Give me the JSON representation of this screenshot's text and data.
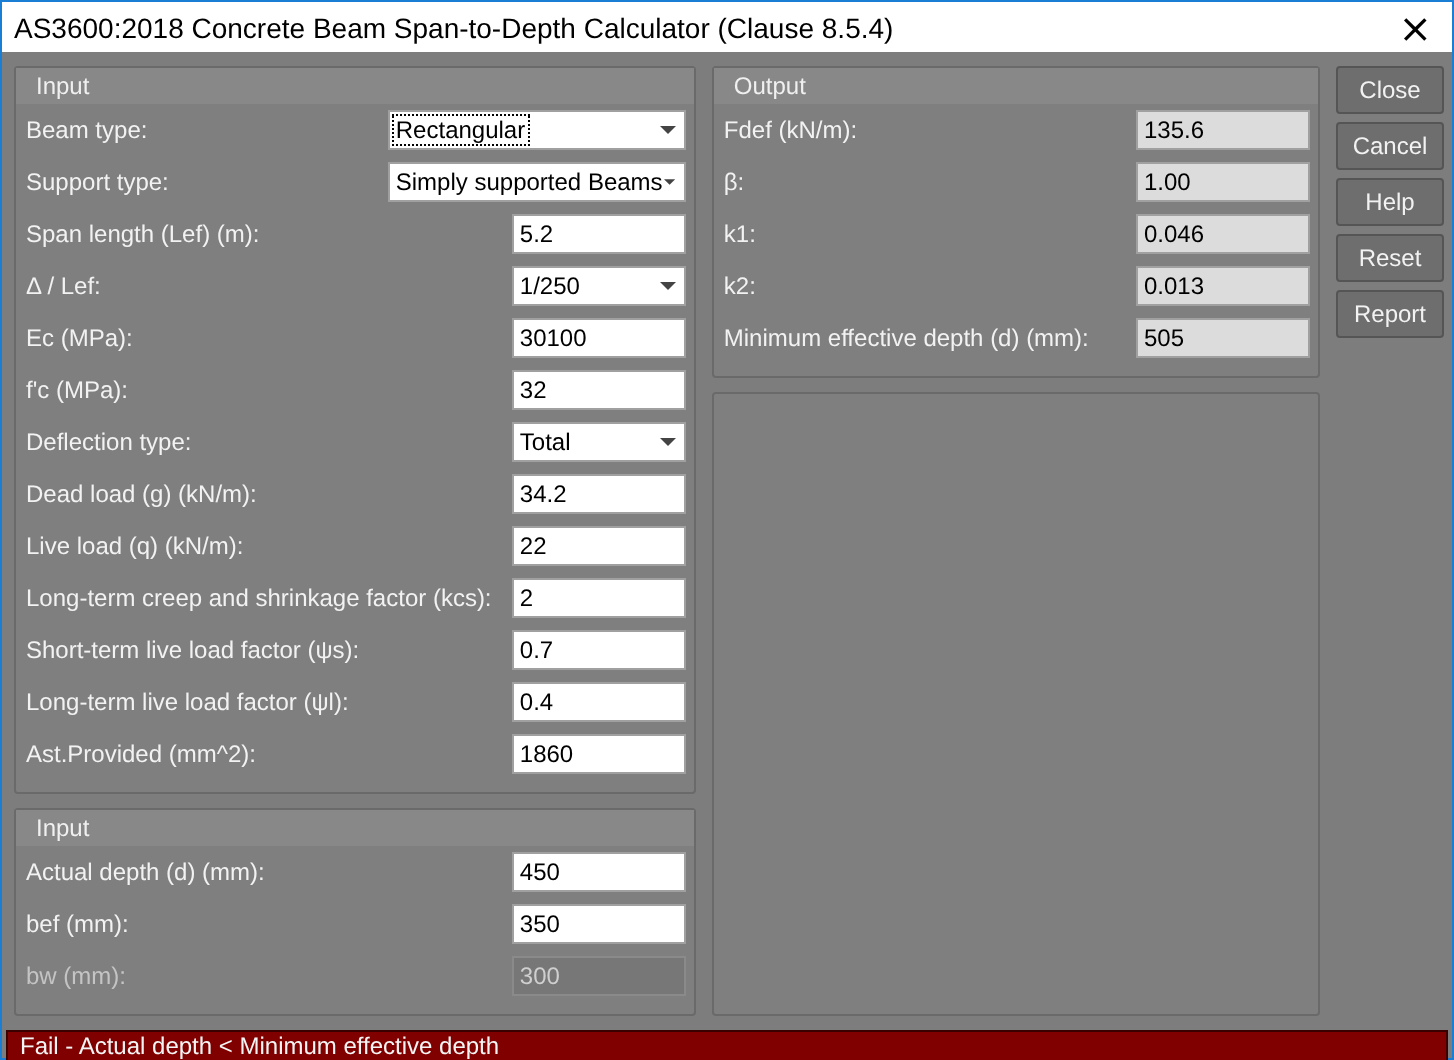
{
  "window": {
    "title": "AS3600:2018 Concrete Beam Span-to-Depth Calculator (Clause 8.5.4)",
    "close": "×"
  },
  "input_panel": {
    "title": "Input",
    "rows": [
      {
        "label": "Beam type:",
        "value": "Rectangular",
        "kind": "select",
        "wide": true,
        "focused": true
      },
      {
        "label": "Support type:",
        "value": "Simply supported Beams",
        "kind": "select",
        "wide": true,
        "focused": false
      },
      {
        "label": "Span length (Lef) (m):",
        "value": "5.2",
        "kind": "text"
      },
      {
        "label": "Δ / Lef:",
        "value": "1/250",
        "kind": "select",
        "wide": false,
        "focused": false
      },
      {
        "label": "Ec (MPa):",
        "value": "30100",
        "kind": "text"
      },
      {
        "label": "f'c (MPa):",
        "value": "32",
        "kind": "text"
      },
      {
        "label": "Deflection type:",
        "value": "Total",
        "kind": "select",
        "wide": false,
        "focused": false
      },
      {
        "label": "Dead load (g) (kN/m):",
        "value": "34.2",
        "kind": "text"
      },
      {
        "label": "Live load (q) (kN/m):",
        "value": "22",
        "kind": "text"
      },
      {
        "label": "Long-term creep and shrinkage factor (kcs):",
        "value": "2",
        "kind": "text"
      },
      {
        "label": "Short-term live load factor (ψs):",
        "value": "0.7",
        "kind": "text"
      },
      {
        "label": "Long-term live load factor (ψl):",
        "value": "0.4",
        "kind": "text"
      },
      {
        "label": "Ast.Provided (mm^2):",
        "value": "1860",
        "kind": "text"
      }
    ]
  },
  "section_panel": {
    "title": "Input",
    "rows": [
      {
        "label": "Actual depth (d) (mm):",
        "value": "450",
        "disabled": false
      },
      {
        "label": "bef (mm):",
        "value": "350",
        "disabled": false
      },
      {
        "label": "bw (mm):",
        "value": "300",
        "disabled": true
      }
    ]
  },
  "output_panel": {
    "title": "Output",
    "rows": [
      {
        "label": "Fdef (kN/m):",
        "value": "135.6"
      },
      {
        "label": "β:",
        "value": "1.00"
      },
      {
        "label": "k1:",
        "value": "0.046"
      },
      {
        "label": "k2:",
        "value": "0.013"
      },
      {
        "label": "Minimum effective depth (d) (mm):",
        "value": "505"
      }
    ]
  },
  "buttons": [
    "Close",
    "Cancel",
    "Help",
    "Reset",
    "Report"
  ],
  "status_bar": {
    "text": "Fail - Actual depth < Minimum effective depth"
  }
}
